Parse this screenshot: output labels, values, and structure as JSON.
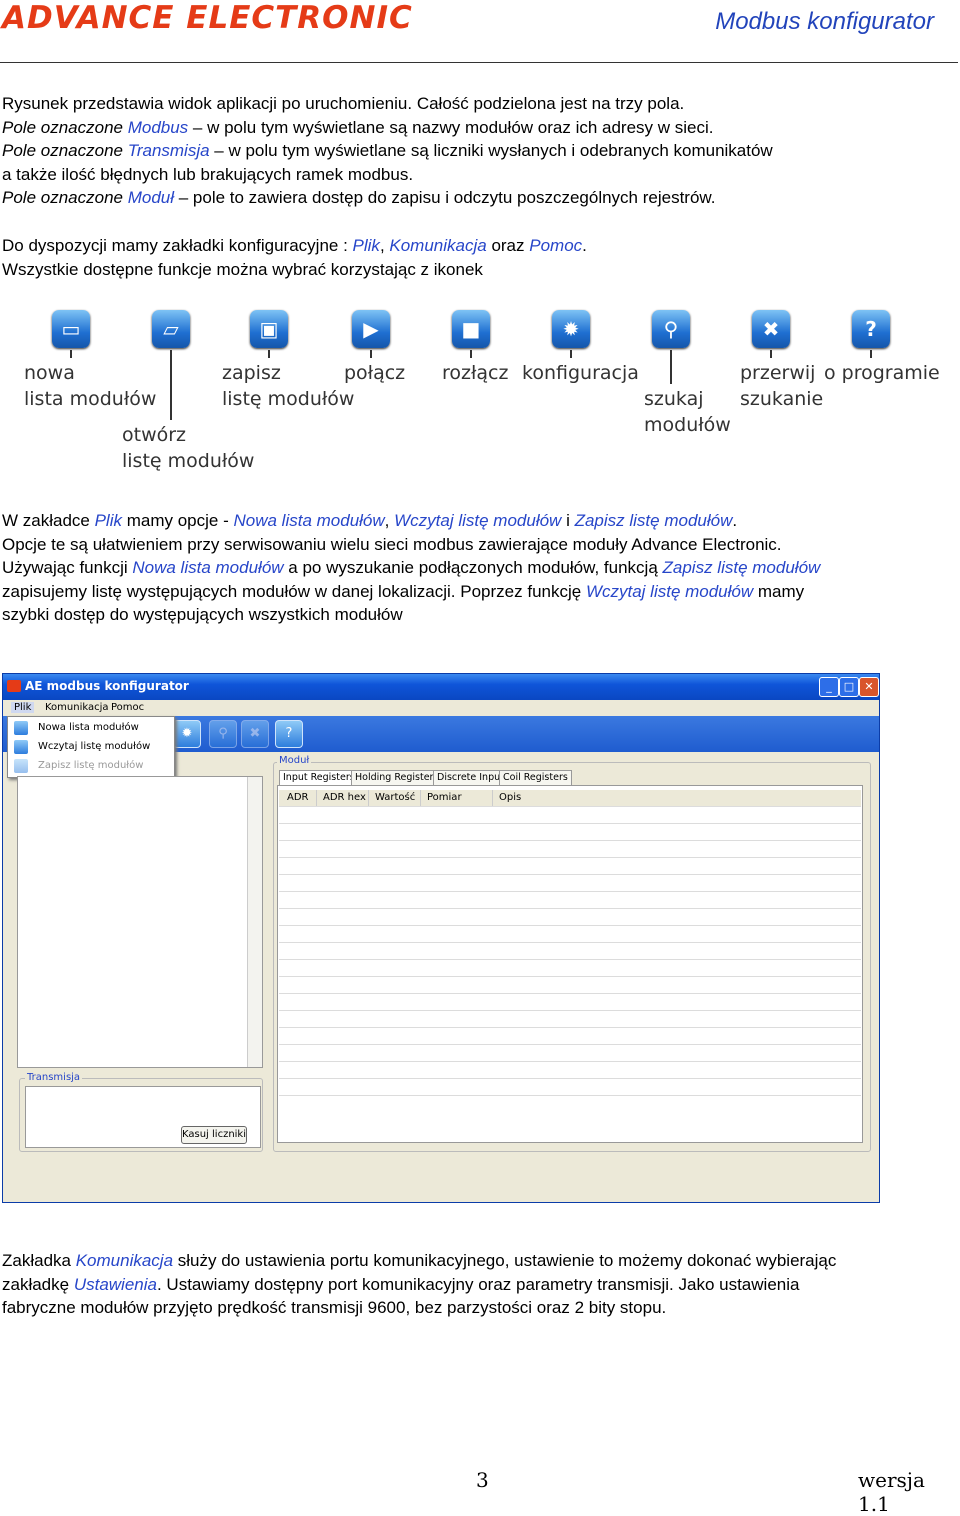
{
  "header": {
    "brand": "ADVANCE ELECTRONIC",
    "title": "Modbus konfigurator"
  },
  "intro": [
    [
      {
        "t": "Rysunek przedstawia widok aplikacji po uruchomieniu. Całość  podzielona jest na trzy pola."
      }
    ],
    [
      {
        "t": "Pole oznaczone ",
        "c": "ital"
      },
      {
        "t": "Modbus",
        "c": "blue"
      },
      {
        "t": " – w polu tym wyświetlane są nazwy modułów oraz ich adresy w sieci."
      }
    ],
    [
      {
        "t": "Pole oznaczone ",
        "c": "ital"
      },
      {
        "t": "Transmisja",
        "c": "blue"
      },
      {
        "t": "  – w polu tym wyświetlane są liczniki wysłanych i odebranych komunikatów"
      }
    ],
    [
      {
        "t": "a także ilość błędnych lub brakujących ramek modbus."
      }
    ],
    [
      {
        "t": "Pole oznaczone ",
        "c": "ital"
      },
      {
        "t": "Moduł",
        "c": "blue"
      },
      {
        "t": " –  pole to zawiera dostęp do zapisu i odczytu poszczególnych rejestrów."
      }
    ]
  ],
  "tabs_para": [
    [
      {
        "t": "Do dyspozycji mamy zakładki konfiguracyjne :  "
      },
      {
        "t": "Plik",
        "c": "blue"
      },
      {
        "t": ", "
      },
      {
        "t": "Komunikacja",
        "c": "blue"
      },
      {
        "t": "  oraz "
      },
      {
        "t": "Pomoc",
        "c": "blue"
      },
      {
        "t": "."
      }
    ],
    [
      {
        "t": "Wszystkie dostępne funkcje można wybrać korzystając z ikonek"
      }
    ]
  ],
  "icons": [
    {
      "name": "new-list-icon",
      "glyph": "▭",
      "label": [
        "nowa",
        "lista modułów"
      ]
    },
    {
      "name": "open-list-icon",
      "glyph": "▱",
      "label": [
        "otwórz",
        "listę modułów"
      ]
    },
    {
      "name": "save-list-icon",
      "glyph": "▣",
      "label": [
        "zapisz",
        "listę modułów"
      ]
    },
    {
      "name": "connect-icon",
      "glyph": "▶",
      "label": [
        "połącz"
      ]
    },
    {
      "name": "disconnect-icon",
      "glyph": "■",
      "label": [
        "rozłącz"
      ]
    },
    {
      "name": "config-icon",
      "glyph": "✹",
      "label": [
        "konfiguracja"
      ]
    },
    {
      "name": "search-icon",
      "glyph": "⚲",
      "label": [
        "szukaj",
        "modułów"
      ]
    },
    {
      "name": "stop-search-icon",
      "glyph": "✖",
      "label": [
        "przerwij",
        "szukanie"
      ]
    },
    {
      "name": "about-icon",
      "glyph": "?",
      "label": [
        "o programie"
      ]
    }
  ],
  "plik_para": [
    [
      {
        "t": "W zakładce "
      },
      {
        "t": "Plik",
        "c": "blue"
      },
      {
        "t": "  mamy opcje  - "
      },
      {
        "t": "Nowa lista modułów",
        "c": "blue"
      },
      {
        "t": ", "
      },
      {
        "t": "Wczytaj listę modułów",
        "c": "blue"
      },
      {
        "t": " i "
      },
      {
        "t": "Zapisz listę modułów",
        "c": "blue"
      },
      {
        "t": "."
      }
    ],
    [
      {
        "t": "Opcje te są ułatwieniem przy serwisowaniu wielu sieci modbus zawierające moduły Advance Electronic."
      }
    ],
    [
      {
        "t": "Używając funkcji "
      },
      {
        "t": "Nowa lista modułów",
        "c": "blue"
      },
      {
        "t": "  a po wyszukanie podłączonych modułów, funkcją "
      },
      {
        "t": "Zapisz listę modułów",
        "c": "blue"
      }
    ],
    [
      {
        "t": "zapisujemy listę występujących modułów w danej lokalizacji. Poprzez funkcję "
      },
      {
        "t": "Wczytaj listę modułów",
        "c": "blue"
      },
      {
        "t": " mamy"
      }
    ],
    [
      {
        "t": "szybki dostęp do występujących wszystkich modułów"
      }
    ]
  ],
  "app": {
    "title": "AE modbus konfigurator",
    "menu": [
      "Plik",
      "Komunikacja",
      "Pomoc"
    ],
    "dropdown": [
      "Nowa lista modułów",
      "Wczytaj listę modułów",
      "Zapisz listę modułów"
    ],
    "module_group": "Moduł",
    "tabs": [
      "Input Registers",
      "Holding Registers",
      "Discrete Input",
      "Coil Registers"
    ],
    "columns": [
      "ADR",
      "ADR hex",
      "Wartość",
      "Pomiar",
      "Opis"
    ],
    "transmission_group": "Transmisja",
    "reset_button": "Kasuj liczniki",
    "win_buttons": [
      "_",
      "□",
      "✕"
    ]
  },
  "komunikacja_para": [
    [
      {
        "t": "Zakładka "
      },
      {
        "t": "Komunikacja",
        "c": "blue"
      },
      {
        "t": "  służy do ustawienia portu komunikacyjnego, ustawienie to możemy dokonać wybierając"
      }
    ],
    [
      {
        "t": "zakładkę "
      },
      {
        "t": "Ustawienia",
        "c": "blue"
      },
      {
        "t": ".  Ustawiamy dostępny port komunikacyjny oraz parametry transmisji. Jako ustawienia"
      }
    ],
    [
      {
        "t": "fabryczne modułów przyjęto prędkość transmisji 9600, bez parzystości oraz 2 bity stopu."
      }
    ]
  ],
  "footer": {
    "page": "3",
    "version": "wersja  1.1"
  }
}
